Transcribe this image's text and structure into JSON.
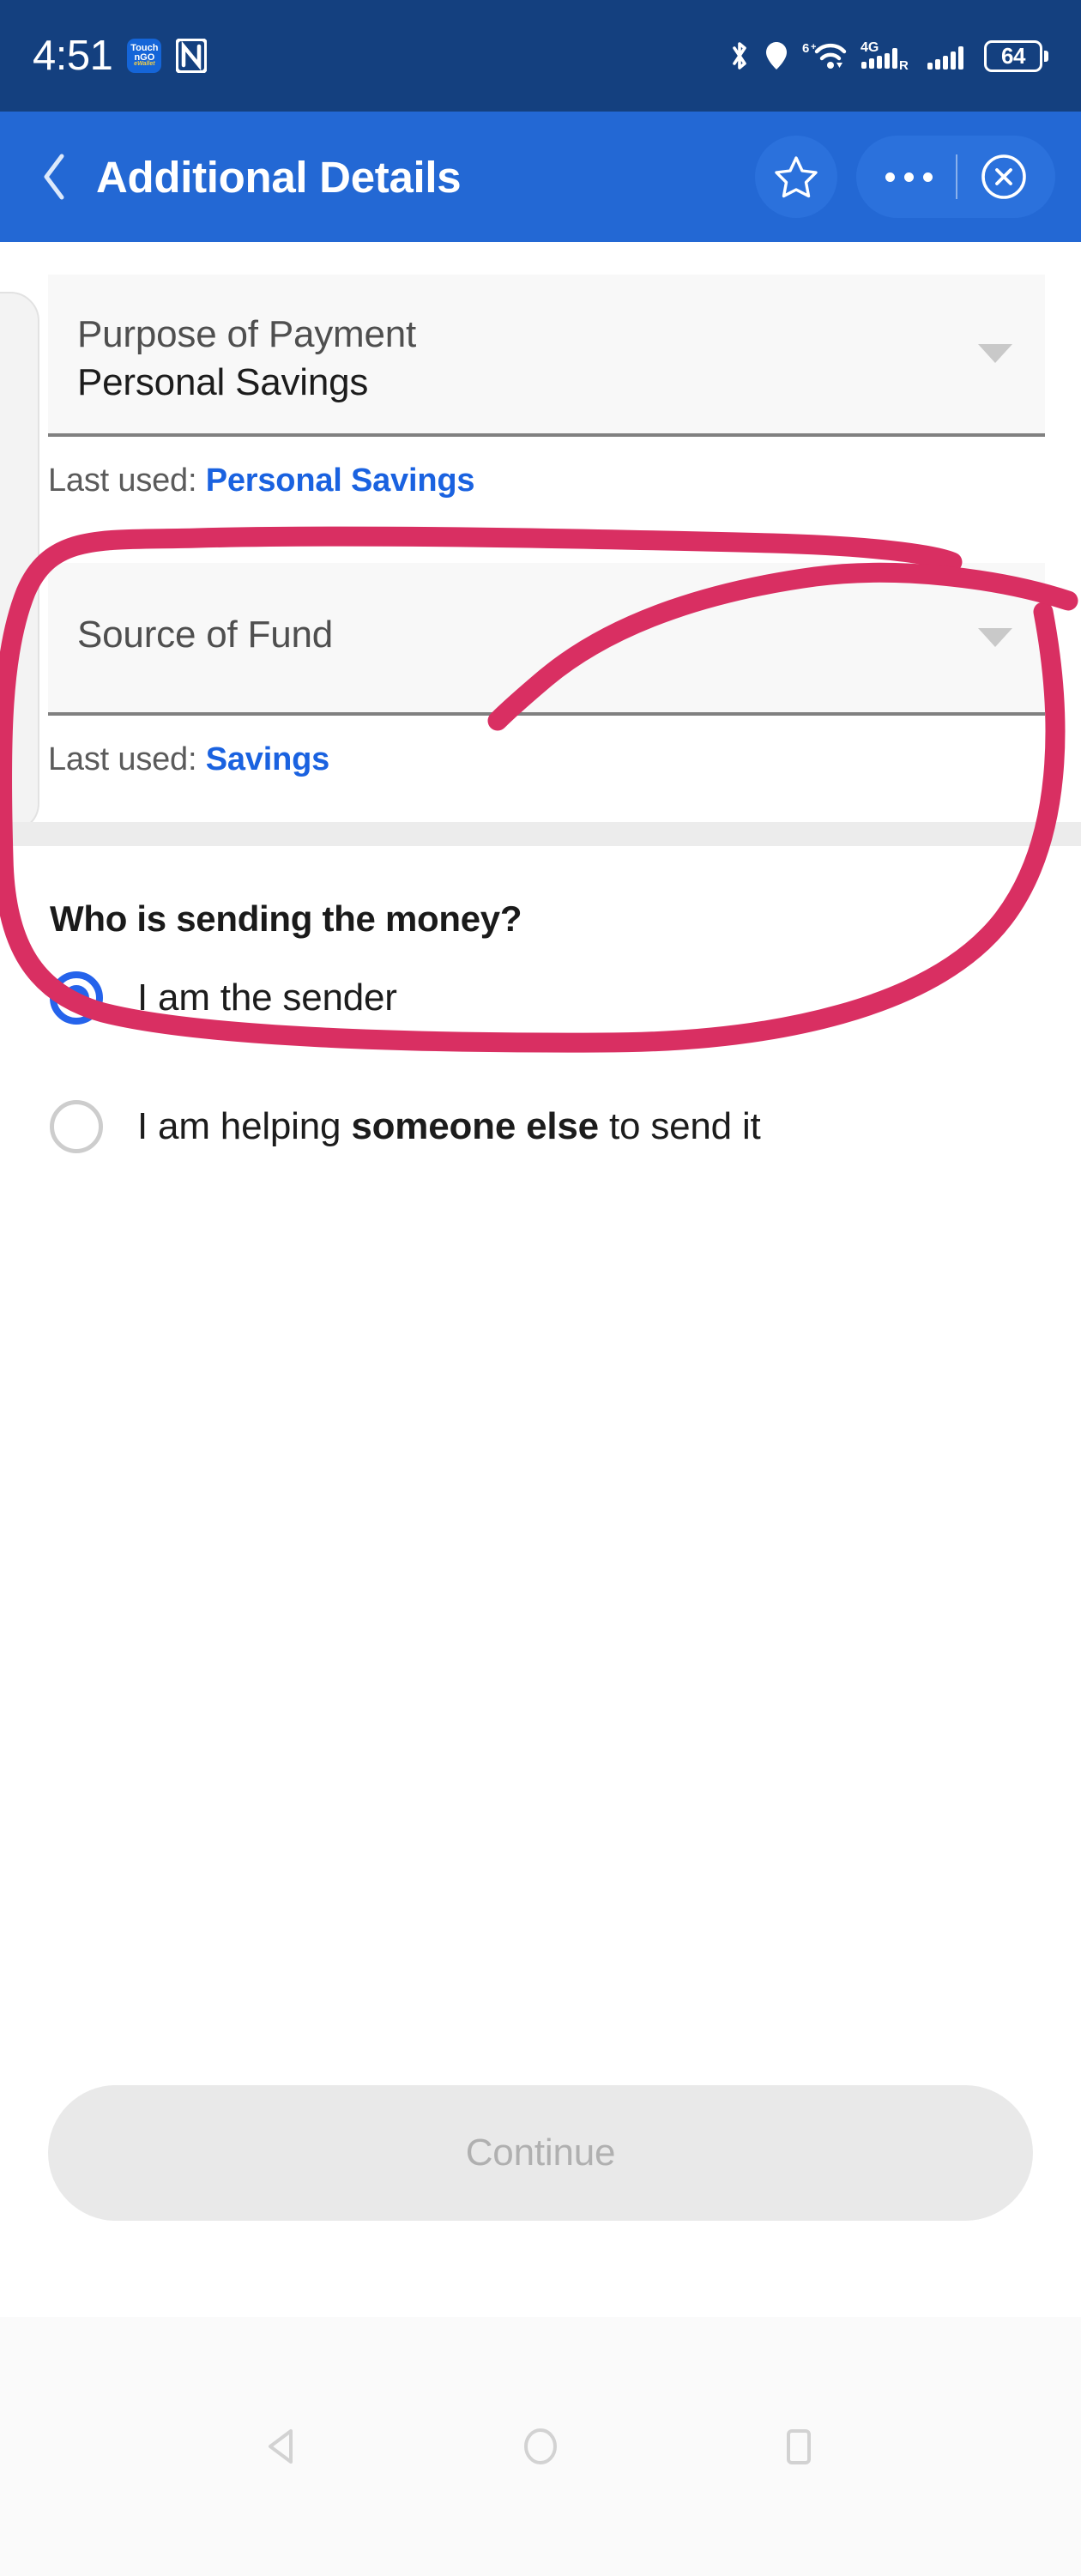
{
  "status_bar": {
    "time": "4:51",
    "app_icon_lines": [
      "Touch",
      "nGO",
      "eWallet"
    ],
    "icons": [
      "tng-ewallet-icon",
      "nfc-icon",
      "bluetooth-icon",
      "location-pin-icon",
      "wifi-6plus-icon",
      "signal-4g-r-icon",
      "signal-bars-icon",
      "battery-icon"
    ],
    "wifi_label": "6",
    "wifi_plus": "+",
    "network_label": "4G",
    "roaming_label": "R",
    "battery_level": "64",
    "background_color": "#14407f"
  },
  "app_bar": {
    "back_label": "back-chevron",
    "title": "Additional Details",
    "star_label": "favorite",
    "dots_label": "more-options",
    "close_label": "close",
    "background_color": "#2368d4"
  },
  "form": {
    "fields": [
      {
        "id": "purpose-of-payment",
        "label": "Purpose of Payment",
        "value": "Personal Savings",
        "last_used_prefix": "Last used:",
        "last_used_value": "Personal Savings",
        "has_value": true
      },
      {
        "id": "source-of-fund",
        "label": "Source of Fund",
        "value": "",
        "last_used_prefix": "Last used:",
        "last_used_value": "Savings",
        "has_value": false
      }
    ]
  },
  "sender_section": {
    "question": "Who is sending the money?",
    "options": [
      {
        "id": "i-am-the-sender",
        "label": "I am the sender",
        "selected": true
      },
      {
        "id": "helping-someone-else",
        "label_pre": "I am helping ",
        "label_bold": "someone else",
        "label_post": " to send it",
        "selected": false
      }
    ]
  },
  "footer": {
    "continue_label": "Continue",
    "continue_enabled": false
  },
  "nav_bar": {
    "items": [
      "back-triangle-icon",
      "home-circle-icon",
      "recents-square-icon"
    ]
  },
  "annotation": {
    "type": "hand-drawn-circle",
    "color": "#d92f62",
    "target": "source-of-fund",
    "stroke_width": 22
  },
  "colors": {
    "accent_blue": "#2563eb",
    "link_blue": "#1a62e0",
    "status_bar": "#14407f",
    "app_bar": "#2368d4",
    "annotation_pink": "#d92f62",
    "field_bg": "#f8f8f8",
    "disabled_btn": "#e9e9e9"
  }
}
